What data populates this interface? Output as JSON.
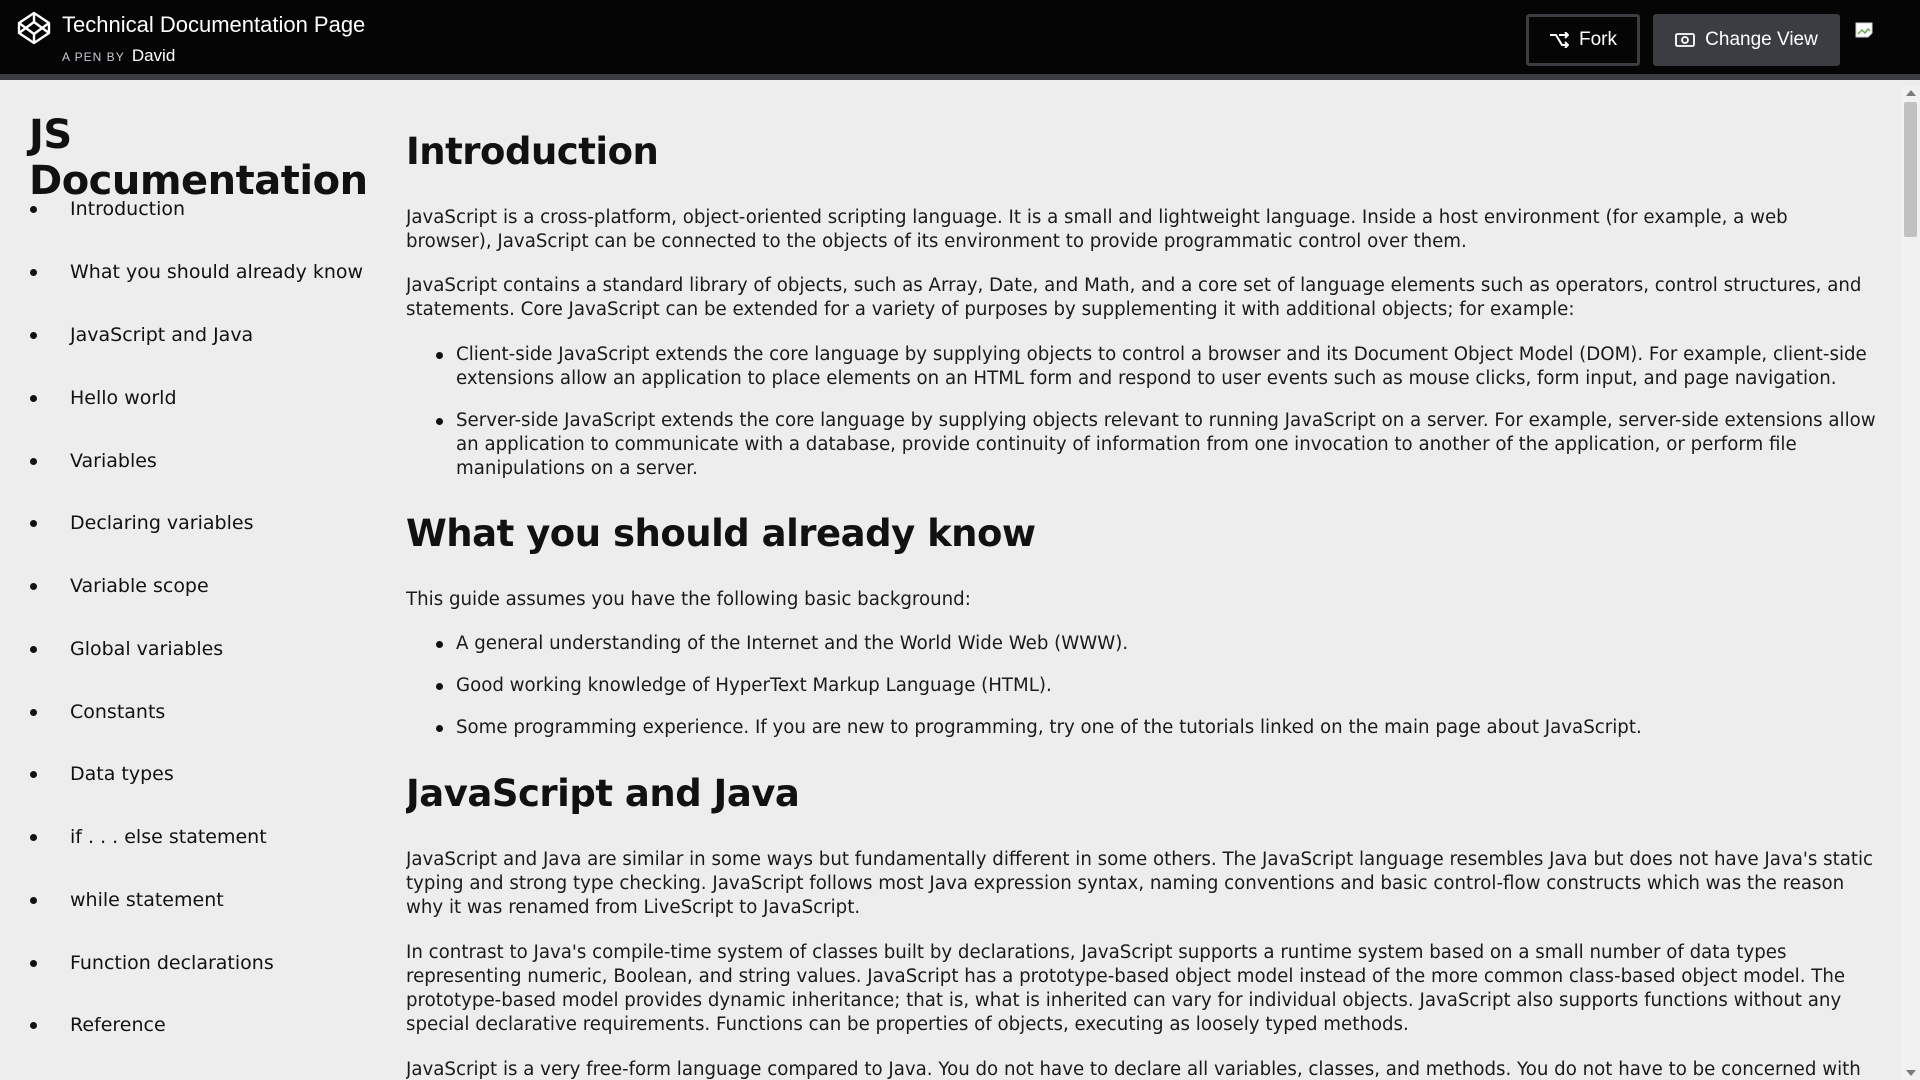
{
  "header": {
    "title": "Technical Documentation Page",
    "by_label": "A PEN BY",
    "author": "David",
    "fork_label": "Fork",
    "change_view_label": "Change View",
    "logo_icon": "codepen-logo-icon",
    "fork_icon": "fork-icon",
    "change_view_icon": "eye-icon"
  },
  "sidebar": {
    "title": "JS Documentation",
    "items": [
      "Introduction",
      "What you should already know",
      "JavaScript and Java",
      "Hello world",
      "Variables",
      "Declaring variables",
      "Variable scope",
      "Global variables",
      "Constants",
      "Data types",
      "if . . . else statement",
      "while statement",
      "Function declarations",
      "Reference"
    ]
  },
  "main": {
    "intro": {
      "heading": "Introduction",
      "p1": "JavaScript is a cross-platform, object-oriented scripting language. It is a small and lightweight language. Inside a host environment (for example, a web browser), JavaScript can be connected to the objects of its environment to provide programmatic control over them.",
      "p2": "JavaScript contains a standard library of objects, such as Array, Date, and Math, and a core set of language elements such as operators, control structures, and statements. Core JavaScript can be extended for a variety of purposes by supplementing it with additional objects; for example:",
      "bullets": [
        "Client-side JavaScript extends the core language by supplying objects to control a browser and its Document Object Model (DOM). For example, client-side extensions allow an application to place elements on an HTML form and respond to user events such as mouse clicks, form input, and page navigation.",
        "Server-side JavaScript extends the core language by supplying objects relevant to running JavaScript on a server. For example, server-side extensions allow an application to communicate with a database, provide continuity of information from one invocation to another of the application, or perform file manipulations on a server."
      ]
    },
    "know": {
      "heading": "What you should already know",
      "p1": "This guide assumes you have the following basic background:",
      "bullets": [
        "A general understanding of the Internet and the World Wide Web (WWW).",
        "Good working knowledge of HyperText Markup Language (HTML).",
        "Some programming experience. If you are new to programming, try one of the tutorials linked on the main page about JavaScript."
      ]
    },
    "java": {
      "heading": "JavaScript and Java",
      "p1": "JavaScript and Java are similar in some ways but fundamentally different in some others. The JavaScript language resembles Java but does not have Java's static typing and strong type checking. JavaScript follows most Java expression syntax, naming conventions and basic control-flow constructs which was the reason why it was renamed from LiveScript to JavaScript.",
      "p2": "In contrast to Java's compile-time system of classes built by declarations, JavaScript supports a runtime system based on a small number of data types representing numeric, Boolean, and string values. JavaScript has a prototype-based object model instead of the more common class-based object model. The prototype-based model provides dynamic inheritance; that is, what is inherited can vary for individual objects. JavaScript also supports functions without any special declarative requirements. Functions can be properties of objects, executing as loosely typed methods.",
      "p3": "JavaScript is a very free-form language compared to Java. You do not have to declare all variables, classes, and methods. You do not have to be concerned with whether"
    }
  }
}
